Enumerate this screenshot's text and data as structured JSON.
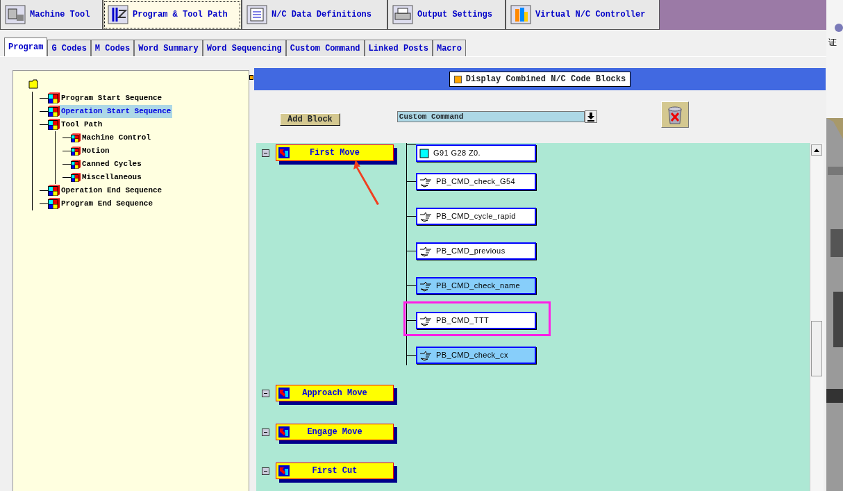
{
  "top_tabs": [
    {
      "label": "Machine Tool",
      "selected": false
    },
    {
      "label": "Program & Tool Path",
      "selected": true
    },
    {
      "label": "N/C Data Definitions",
      "selected": false
    },
    {
      "label": "Output Settings",
      "selected": false
    },
    {
      "label": "Virtual N/C Controller",
      "selected": false
    }
  ],
  "sub_tabs": [
    {
      "label": "Program",
      "selected": true
    },
    {
      "label": "G Codes",
      "selected": false
    },
    {
      "label": "M Codes",
      "selected": false
    },
    {
      "label": "Word Summary",
      "selected": false
    },
    {
      "label": "Word Sequencing",
      "selected": false
    },
    {
      "label": "Custom Command",
      "selected": false
    },
    {
      "label": "Linked Posts",
      "selected": false
    },
    {
      "label": "Macro",
      "selected": false
    }
  ],
  "tree": {
    "items": [
      {
        "label": "Program Start Sequence",
        "selected": false
      },
      {
        "label": "Operation Start Sequence",
        "selected": true
      },
      {
        "label": "Tool Path",
        "selected": false,
        "children": [
          {
            "label": "Machine Control",
            "selected": false
          },
          {
            "label": "Motion",
            "selected": false
          },
          {
            "label": "Canned Cycles",
            "selected": false
          },
          {
            "label": "Miscellaneous",
            "selected": false
          }
        ]
      },
      {
        "label": "Operation End Sequence",
        "selected": false
      },
      {
        "label": "Program End Sequence",
        "selected": false
      }
    ]
  },
  "toolbar": {
    "display_combined": {
      "label": "Display Combined N/C Code Blocks",
      "checked": true
    },
    "add_block": "Add Block",
    "block_type": {
      "value": "Custom Command"
    }
  },
  "sequence": {
    "events": [
      {
        "label": "First Move",
        "pointed": true,
        "blocks": [
          {
            "label": "G91 G28 Z0.",
            "kind": "code",
            "selected": false,
            "highlighted": false
          },
          {
            "label": "PB_CMD_check_G54",
            "kind": "command",
            "selected": false,
            "highlighted": false
          },
          {
            "label": "PB_CMD_cycle_rapid",
            "kind": "command",
            "selected": false,
            "highlighted": false
          },
          {
            "label": "PB_CMD_previous",
            "kind": "command",
            "selected": false,
            "highlighted": false
          },
          {
            "label": "PB_CMD_check_name",
            "kind": "command",
            "selected": true,
            "highlighted": false
          },
          {
            "label": "PB_CMD_TTT",
            "kind": "command",
            "selected": false,
            "highlighted": true
          },
          {
            "label": "PB_CMD_check_cx",
            "kind": "command",
            "selected": true,
            "highlighted": false
          }
        ]
      },
      {
        "label": "Approach Move",
        "pointed": false
      },
      {
        "label": "Engage Move",
        "pointed": false
      },
      {
        "label": "First Cut",
        "pointed": false
      }
    ]
  },
  "background_window": {
    "text": "证"
  }
}
